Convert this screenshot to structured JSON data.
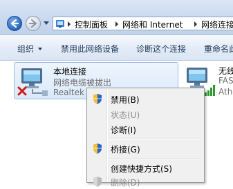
{
  "address_bar": {
    "breadcrumbs": [
      "控制面板",
      "网络和 Internet",
      "网络连接"
    ]
  },
  "toolbar": {
    "items": [
      {
        "label": "组织",
        "dropdown": true
      },
      {
        "label": "禁用此网络设备"
      },
      {
        "label": "诊断这个连接"
      },
      {
        "label": "重命名此"
      }
    ]
  },
  "connections": [
    {
      "name": "本地连接",
      "status": "网络电缆被拔出",
      "device": "Realtek P"
    },
    {
      "name": "无线",
      "status": "FAS",
      "device": "Athe"
    }
  ],
  "context_menu": {
    "items": [
      {
        "label": "禁用(B)",
        "shield": true,
        "enabled": true
      },
      {
        "label": "状态(U)",
        "enabled": false
      },
      {
        "label": "诊断(I)",
        "enabled": true
      },
      {
        "label": "桥接(G)",
        "shield": true,
        "enabled": true
      },
      {
        "label": "创建快捷方式(S)",
        "enabled": true
      },
      {
        "label": "删除(D)",
        "shield": true,
        "enabled": false
      }
    ]
  },
  "colors": {
    "toolbar_text": "#1e395b",
    "selection_bg": "#d9e9fa",
    "selection_border": "#99bde4",
    "disabled_text": "#8d8d8d"
  },
  "icons": [
    "back-arrow-icon",
    "forward-arrow-icon",
    "dropdown-arrow-icon",
    "control-panel-icon",
    "network-adapter-icon",
    "disconnected-x-icon",
    "wireless-signal-icon",
    "uac-shield-icon"
  ]
}
